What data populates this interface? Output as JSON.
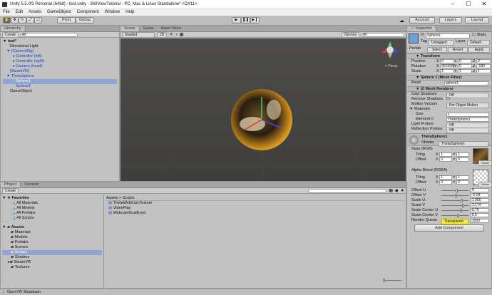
{
  "window": {
    "title": "Unity 5.5.0f3 Personal (64bit) - test.unity - 360ViewTutorial - PC, Mac & Linux Standalone* <DX11>"
  },
  "menu": [
    "File",
    "Edit",
    "Assets",
    "GameObject",
    "Component",
    "Window",
    "Help"
  ],
  "toolbar": {
    "pivot": "Pivot",
    "global": "Global",
    "account": "Account",
    "layers": "Layers",
    "layout": "Layout"
  },
  "hierarchy": {
    "tab": "Hierarchy",
    "create": "Create",
    "search_placeholder": "All",
    "items": [
      "test*",
      "Directional Light",
      "[CameraRig]",
      "Controller (left)",
      "Controller (right)",
      "Camera (head)",
      "[SteamVR]",
      "ThetaSphere",
      "Sphere1",
      "Sphere2",
      "GameObject"
    ]
  },
  "scene": {
    "tabs": [
      "Scene",
      "Game",
      "Asset Store"
    ],
    "shaded": "Shaded",
    "mode2d": "2D",
    "gizmos": "Gizmos",
    "search": "All",
    "persp": "< Persp"
  },
  "project": {
    "tabs": [
      "Project",
      "Console"
    ],
    "create": "Create",
    "breadcrumb": "Assets > Scripts",
    "favorites_label": "Favorites",
    "favorites": [
      "All Materials",
      "All Models",
      "All Prefabs",
      "All Scripts"
    ],
    "assets_label": "Assets",
    "folders": [
      "Materials",
      "Models",
      "Prefabs",
      "Scenes",
      "Scripts",
      "Shaders",
      "SteamVR",
      "Textures"
    ],
    "files": [
      "ThetaWebCamTexture",
      "VideoPlay",
      "WebcamDualEyed"
    ]
  },
  "inspector": {
    "tab": "Inspector",
    "name": "Sphere1",
    "static": "Static",
    "tag_label": "Tag",
    "tag": "Untagged",
    "layer_label": "Layer",
    "layer": "Default",
    "prefab_label": "Prefab",
    "prefab_select": "Select",
    "prefab_revert": "Revert",
    "prefab_apply": "Apply",
    "transform": {
      "title": "Transform",
      "position": "Position",
      "rotation": "Rotation",
      "scale": "Scale",
      "pos": [
        "0",
        "0",
        "0"
      ],
      "rot": [
        "90.0000",
        "0",
        "-180"
      ],
      "scl": [
        "1",
        "1",
        "1"
      ]
    },
    "meshfilter": {
      "title": "Sphere 1 (Mesh Filter)",
      "mesh_label": "Mesh",
      "mesh": "sphere1"
    },
    "meshrenderer": {
      "title": "Mesh Renderer",
      "cast_shadows": "Cast Shadows",
      "cast_val": "Off",
      "receive_shadows": "Receive Shadows",
      "motion_vectors": "Motion Vectors",
      "motion_val": "Per Object Motion",
      "materials": "Materials",
      "size_label": "Size",
      "size": "1",
      "element0_label": "Element 0",
      "element0": "ThetaSphere1",
      "light_probes": "Light Probes",
      "light_val": "Off",
      "reflection_probes": "Reflection Probes",
      "reflection_val": "Off"
    },
    "material": {
      "name": "ThetaSphere1",
      "shader_label": "Shader",
      "shader": "Theta/Sphere1",
      "base": "Base (RGB)",
      "alpha": "Alpha Blend (RGBA)",
      "tiling": "Tiling",
      "offset": "Offset",
      "tile_vals": [
        "1",
        "1"
      ],
      "offset_vals": [
        "0",
        "0"
      ],
      "select": "Select",
      "props": [
        {
          "label": "Offset U",
          "value": "0",
          "fill": 0.55
        },
        {
          "label": "Offset V",
          "value": "-0.04",
          "fill": 0.52
        },
        {
          "label": "Scale U",
          "value": "1.005",
          "fill": 0.75
        },
        {
          "label": "Scale V",
          "value": "1.174",
          "fill": 0.8
        },
        {
          "label": "Scale Center U",
          "value": "0.75",
          "fill": 0.72
        },
        {
          "label": "Scale Center V",
          "value": "0.5",
          "fill": 0.6
        }
      ],
      "render_queue": "Render Queue",
      "queue_mode": "Transparent",
      "queue_val": "3000"
    },
    "add_component": "Add Component"
  },
  "status": "OpenVR Shutdown",
  "colors": {
    "accent": "#8fa6d4",
    "highlight": "#f5e94a"
  }
}
